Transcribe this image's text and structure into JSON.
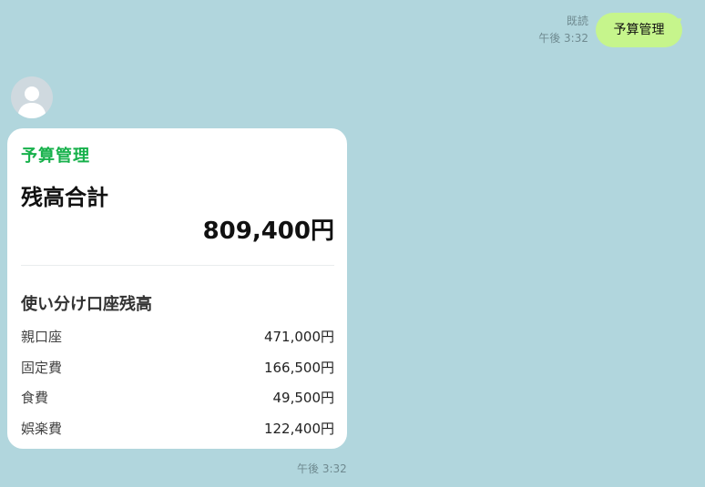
{
  "outgoing": {
    "read_label": "既読",
    "time": "午後 3:32",
    "message": "予算管理"
  },
  "incoming": {
    "time": "午後 3:32",
    "card": {
      "label": "予算管理",
      "title": "残高合計",
      "total": "809,400円",
      "section_title": "使い分け口座残高",
      "rows": [
        {
          "name": "親口座",
          "amount": "471,000円"
        },
        {
          "name": "固定費",
          "amount": "166,500円"
        },
        {
          "name": "食費",
          "amount": "49,500円"
        },
        {
          "name": "娯楽費",
          "amount": "122,400円"
        }
      ],
      "accent_color": "#17b14b"
    }
  },
  "colors": {
    "background": "#b1d6dd",
    "outgoing_bubble": "#c6f58c"
  },
  "icons": {
    "avatar": "default-person-icon"
  }
}
